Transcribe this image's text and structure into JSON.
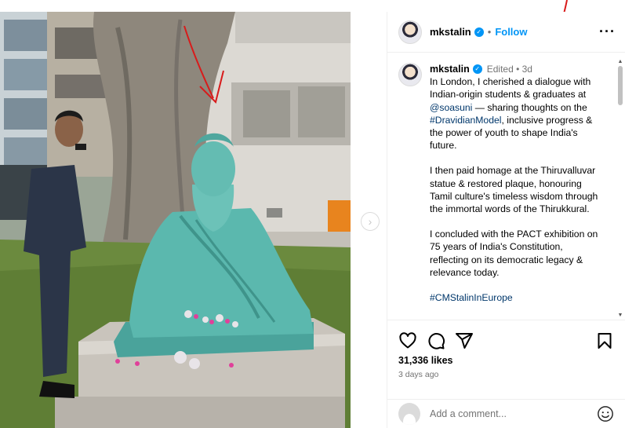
{
  "post": {
    "username": "mkstalin",
    "follow_label": "Follow",
    "dot": "•",
    "more_label": "···"
  },
  "caption": {
    "username": "mkstalin",
    "edited": "Edited • 3d",
    "p1_a": "In London, I cherished a dialogue with Indian-origin students & graduates at ",
    "p1_mention": "@soasuni",
    "p1_b": " — sharing thoughts on the ",
    "p1_tag": "#DravidianModel",
    "p1_c": ", inclusive progress & the power of youth to shape India's future.",
    "p2": "I then paid homage at the Thiruvalluvar statue & restored plaque, honouring Tamil culture's timeless wisdom through the immortal words of the Thirukkural.",
    "p3": "I concluded with the PACT exhibition on 75 years of India's Constitution, reflecting on its democratic legacy & relevance today.",
    "p4_tag": "#CMStalinInEurope"
  },
  "stats": {
    "likes": "31,336 likes",
    "ago": "3 days ago"
  },
  "comment_box": {
    "placeholder": "Add a comment..."
  },
  "carousel": {
    "next_glyph": "›"
  },
  "icons": {
    "verified": "verified-badge-icon",
    "like": "heart-icon",
    "comment": "comment-bubble-icon",
    "share": "paper-plane-icon",
    "save": "bookmark-icon",
    "emoji": "smiley-icon"
  },
  "colors": {
    "accent": "#0095f6",
    "link": "#00376b",
    "muted": "#737373",
    "annotation": "#d81b1b"
  }
}
